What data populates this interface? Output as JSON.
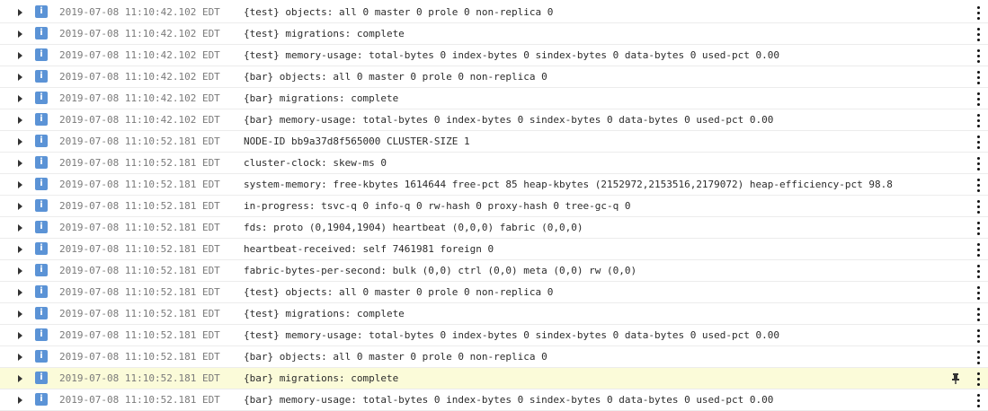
{
  "colors": {
    "level_badge": "#5b93d6",
    "highlight_row": "#fbfbd9",
    "timestamp_text": "#7a7a7a",
    "message_text": "#2b2b2b"
  },
  "icons": {
    "expander": "triangle-right-icon",
    "pin": "pin-icon",
    "menu": "kebab-menu-icon"
  },
  "log": {
    "rows": [
      {
        "level": "i",
        "timestamp": "2019-07-08 11:10:42.102 EDT",
        "message": "{test} objects: all 0 master 0 prole 0 non-replica 0"
      },
      {
        "level": "i",
        "timestamp": "2019-07-08 11:10:42.102 EDT",
        "message": "{test} migrations: complete"
      },
      {
        "level": "i",
        "timestamp": "2019-07-08 11:10:42.102 EDT",
        "message": "{test} memory-usage: total-bytes 0 index-bytes 0 sindex-bytes 0 data-bytes 0 used-pct 0.00"
      },
      {
        "level": "i",
        "timestamp": "2019-07-08 11:10:42.102 EDT",
        "message": "{bar} objects: all 0 master 0 prole 0 non-replica 0"
      },
      {
        "level": "i",
        "timestamp": "2019-07-08 11:10:42.102 EDT",
        "message": "{bar} migrations: complete"
      },
      {
        "level": "i",
        "timestamp": "2019-07-08 11:10:42.102 EDT",
        "message": "{bar} memory-usage: total-bytes 0 index-bytes 0 sindex-bytes 0 data-bytes 0 used-pct 0.00"
      },
      {
        "level": "i",
        "timestamp": "2019-07-08 11:10:52.181 EDT",
        "message": "NODE-ID bb9a37d8f565000 CLUSTER-SIZE 1"
      },
      {
        "level": "i",
        "timestamp": "2019-07-08 11:10:52.181 EDT",
        "message": "cluster-clock: skew-ms 0"
      },
      {
        "level": "i",
        "timestamp": "2019-07-08 11:10:52.181 EDT",
        "message": "system-memory: free-kbytes 1614644 free-pct 85 heap-kbytes (2152972,2153516,2179072) heap-efficiency-pct 98.8"
      },
      {
        "level": "i",
        "timestamp": "2019-07-08 11:10:52.181 EDT",
        "message": "in-progress: tsvc-q 0 info-q 0 rw-hash 0 proxy-hash 0 tree-gc-q 0"
      },
      {
        "level": "i",
        "timestamp": "2019-07-08 11:10:52.181 EDT",
        "message": "fds: proto (0,1904,1904) heartbeat (0,0,0) fabric (0,0,0)"
      },
      {
        "level": "i",
        "timestamp": "2019-07-08 11:10:52.181 EDT",
        "message": "heartbeat-received: self 7461981 foreign 0"
      },
      {
        "level": "i",
        "timestamp": "2019-07-08 11:10:52.181 EDT",
        "message": "fabric-bytes-per-second: bulk (0,0) ctrl (0,0) meta (0,0) rw (0,0)"
      },
      {
        "level": "i",
        "timestamp": "2019-07-08 11:10:52.181 EDT",
        "message": "{test} objects: all 0 master 0 prole 0 non-replica 0"
      },
      {
        "level": "i",
        "timestamp": "2019-07-08 11:10:52.181 EDT",
        "message": "{test} migrations: complete"
      },
      {
        "level": "i",
        "timestamp": "2019-07-08 11:10:52.181 EDT",
        "message": "{test} memory-usage: total-bytes 0 index-bytes 0 sindex-bytes 0 data-bytes 0 used-pct 0.00"
      },
      {
        "level": "i",
        "timestamp": "2019-07-08 11:10:52.181 EDT",
        "message": "{bar} objects: all 0 master 0 prole 0 non-replica 0"
      },
      {
        "level": "i",
        "timestamp": "2019-07-08 11:10:52.181 EDT",
        "message": "{bar} migrations: complete",
        "highlighted": true,
        "pinned": true
      },
      {
        "level": "i",
        "timestamp": "2019-07-08 11:10:52.181 EDT",
        "message": "{bar} memory-usage: total-bytes 0 index-bytes 0 sindex-bytes 0 data-bytes 0 used-pct 0.00"
      }
    ]
  }
}
